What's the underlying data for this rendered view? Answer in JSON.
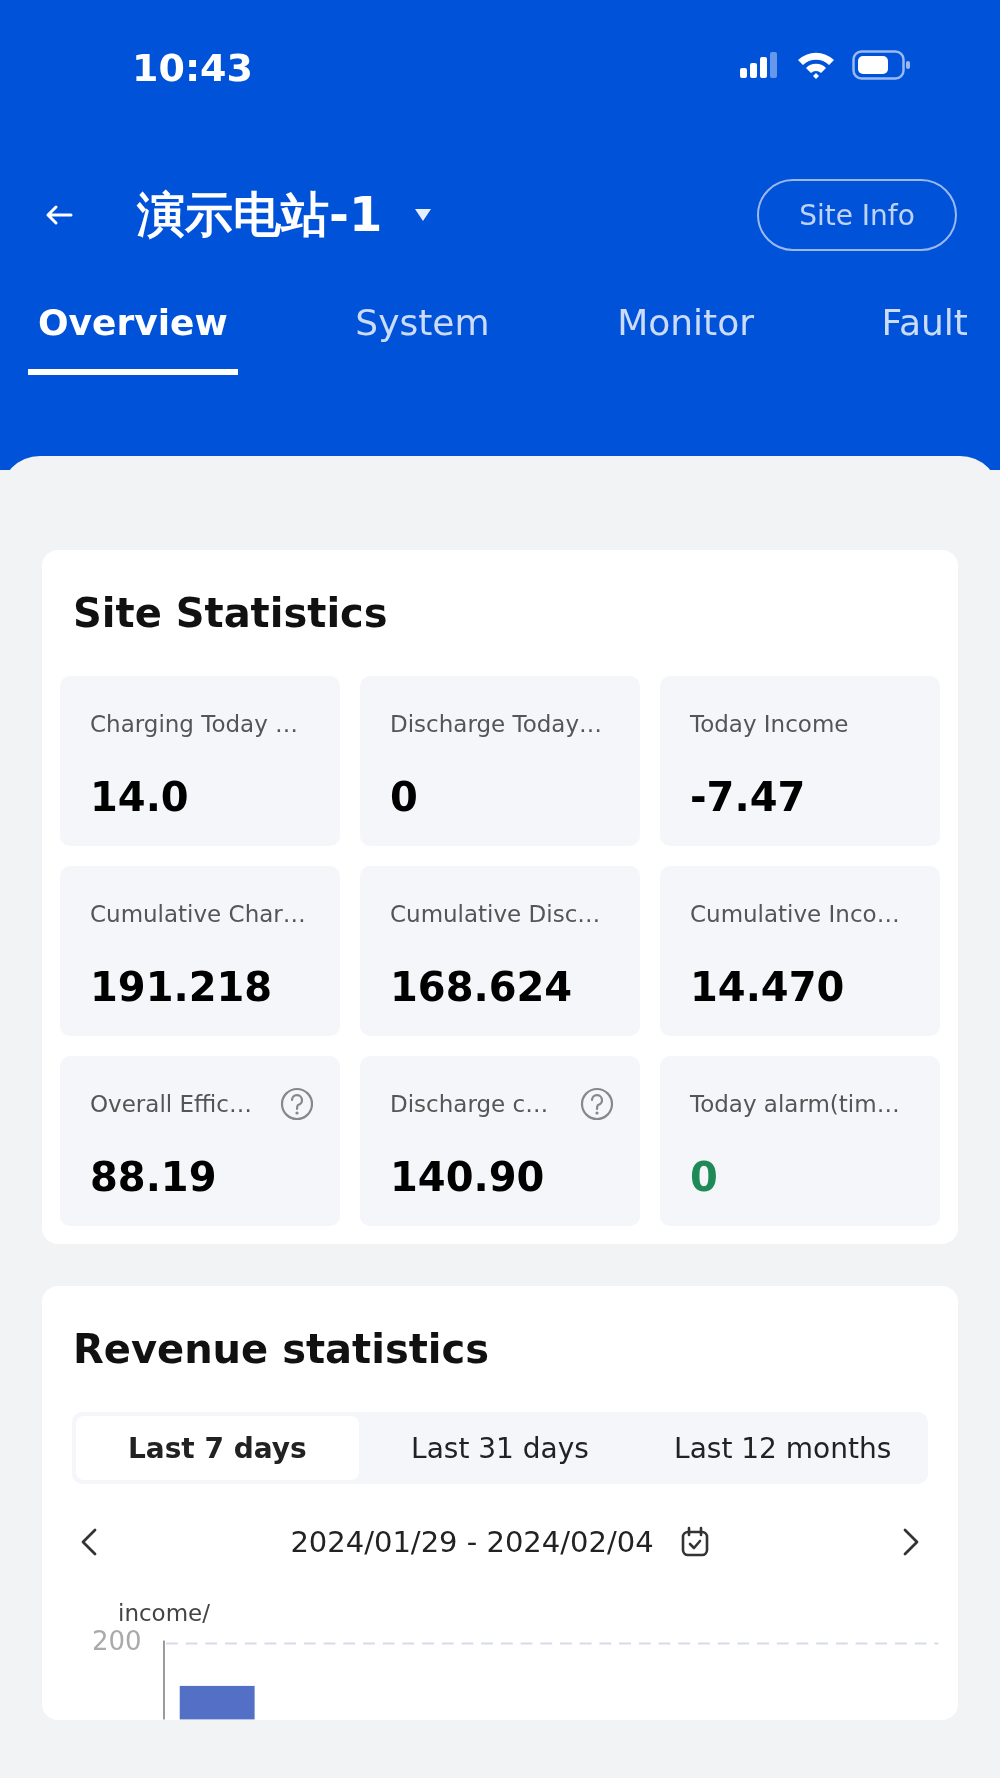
{
  "status_bar": {
    "time": "10:43"
  },
  "header": {
    "title": "演示电站-1",
    "site_info_button": "Site Info"
  },
  "tabs": [
    {
      "label": "Overview",
      "selected": true
    },
    {
      "label": "System",
      "selected": false
    },
    {
      "label": "Monitor",
      "selected": false
    },
    {
      "label": "Fault",
      "selected": false
    }
  ],
  "site_statistics": {
    "title": "Site Statistics",
    "tiles": [
      {
        "label": "Charging Today …",
        "value": "14.0",
        "kind": "plain",
        "color": "#000000"
      },
      {
        "label": "Discharge Today…",
        "value": "0",
        "kind": "plain",
        "color": "#000000"
      },
      {
        "label": "Today Income",
        "value": "-7.47",
        "kind": "plain",
        "color": "#000000"
      },
      {
        "label": "Cumulative Char…",
        "value": "191.218",
        "kind": "plain",
        "color": "#000000"
      },
      {
        "label": "Cumulative Disc…",
        "value": "168.624",
        "kind": "plain",
        "color": "#000000"
      },
      {
        "label": "Cumulative Inco…",
        "value": "14.470",
        "kind": "plain",
        "color": "#000000"
      },
      {
        "label": "Overall Effic…",
        "value": "88.19",
        "kind": "help",
        "color": "#000000"
      },
      {
        "label": "Discharge c…",
        "value": "140.90",
        "kind": "help",
        "color": "#000000"
      },
      {
        "label": "Today alarm(tim…",
        "value": "0",
        "kind": "plain",
        "color": "#1e8a57"
      }
    ]
  },
  "revenue_statistics": {
    "title": "Revenue statistics",
    "periods": [
      {
        "label": "Last 7 days",
        "selected": true
      },
      {
        "label": "Last 31 days",
        "selected": false
      },
      {
        "label": "Last 12 months",
        "selected": false
      }
    ],
    "date_range": "2024/01/29 - 2024/02/04",
    "chart": {
      "unit_label": "income/",
      "tick_label": "200"
    }
  }
}
